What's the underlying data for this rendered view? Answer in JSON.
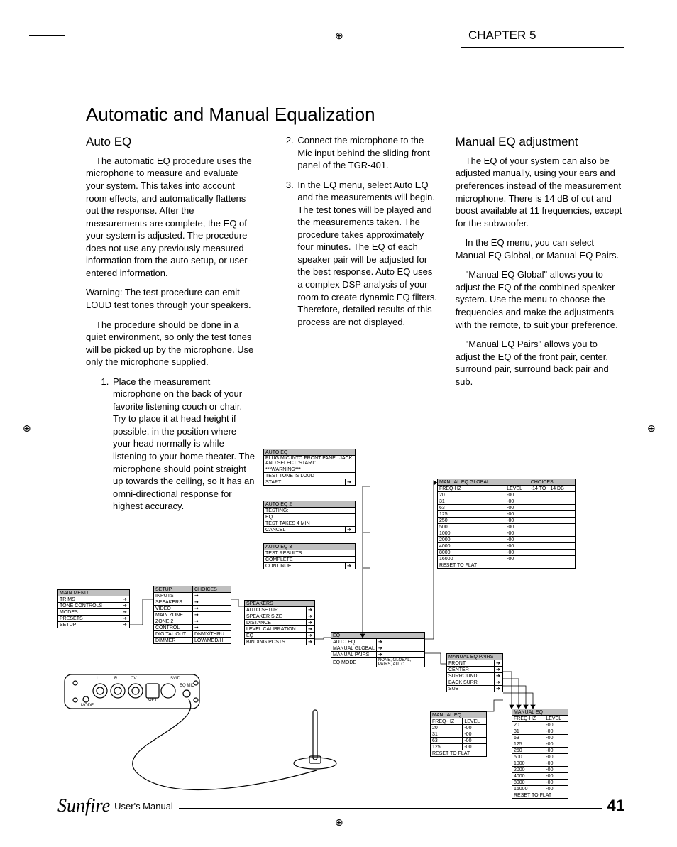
{
  "chapter": "CHAPTER 5",
  "title": "Automatic and Manual Equalization",
  "footer": {
    "brand": "Sunfire",
    "label": "User's Manual",
    "page": "41"
  },
  "col1": {
    "heading": "Auto EQ",
    "p1": "The automatic EQ procedure uses the microphone to measure and evaluate your system. This takes into account room effects, and automatically flattens out the response. After the measurements are complete, the EQ of your system is adjusted. The procedure does not use any previously measured information from the auto setup, or user-entered information.",
    "warn": "Warning: The test procedure can emit LOUD test tones through your speakers.",
    "p2": "The procedure should be done in a quiet environment, so only the test tones will be picked up by the microphone. Use only the microphone supplied.",
    "li1": "Place the measurement microphone on the back of your favorite listening couch or chair. Try to place it at head height if possible, in the position where your head normally is while listening to your home theater. The microphone should point straight up towards the ceiling, so it has an omni-directional response for highest accuracy."
  },
  "col2": {
    "li2": "Connect the microphone to the Mic input behind the sliding front panel of the TGR-401.",
    "li3": "In the EQ menu, select Auto EQ and the measurements will begin. The test tones will be played and the measurements taken. The procedure takes approximately four minutes. The EQ of each speaker pair will be adjusted for the best response. Auto EQ uses a complex DSP analysis of your room to create dynamic EQ filters. Therefore, detailed results of this process are not displayed."
  },
  "col3": {
    "heading": "Manual EQ adjustment",
    "p1": "The EQ of your system can also be adjusted manually, using your ears and preferences instead of the measurement microphone. There is 14 dB of cut and boost available at 11 frequencies, except for the subwoofer.",
    "p2": "In the EQ menu, you can select Manual EQ Global, or Manual EQ Pairs.",
    "p3": "\"Manual EQ Global\" allows you to adjust the EQ of the combined speaker system. Use the menu to choose the frequencies and make the adjustments with the remote, to suit your preference.",
    "p4": "\"Manual EQ Pairs\" allows you to adjust the EQ of the front pair, center, surround pair, surround back pair and sub."
  },
  "menus": {
    "main": {
      "title": "MAIN MENU",
      "rows": [
        "TRIMS",
        "TONE CONTROLS",
        "MODES",
        "PRESETS",
        "SETUP"
      ]
    },
    "setup": {
      "title": "SETUP",
      "choices": "CHOICES",
      "rows": [
        [
          "INPUTS",
          ""
        ],
        [
          "SPEAKERS",
          ""
        ],
        [
          "VIDEO",
          ""
        ],
        [
          "MAIN ZONE",
          ""
        ],
        [
          "ZONE 2",
          ""
        ],
        [
          "CONTROL",
          ""
        ],
        [
          "DIGITAL OUT",
          "DNMX/THRU"
        ],
        [
          "DIMMER",
          "LOW/MED/HI"
        ]
      ]
    },
    "speakers": {
      "title": "SPEAKERS",
      "rows": [
        "AUTO SETUP",
        "SPEAKER SIZE",
        "DISTANCE",
        "LEVEL CALIBRATION",
        "EQ",
        "BINDING POSTS"
      ]
    },
    "eq": {
      "title": "EQ",
      "rows": [
        [
          "AUTO EQ",
          ""
        ],
        [
          "MANUAL GLOBAL",
          ""
        ],
        [
          "MANUAL PAIRS",
          ""
        ],
        [
          "EQ MODE",
          "NONE, GLOBAL, PAIRS, AUTO"
        ]
      ]
    },
    "autoeq1": {
      "title": "AUTO EQ",
      "rows": [
        "PLUG MIC INTO FRONT PANEL JACK AND SELECT 'START'",
        "***WARNING***",
        "TEST TONE IS LOUD",
        "START"
      ]
    },
    "autoeq2": {
      "title": "AUTO EQ 2",
      "rows": [
        "TESTING:",
        "EQ",
        "TEST TAKES 4 MIN",
        "CANCEL"
      ]
    },
    "autoeq3": {
      "title": "AUTO EQ 3",
      "rows": [
        "TEST RESULTS",
        "COMPLETE",
        "CONTINUE"
      ]
    },
    "manpairs": {
      "title": "MANUAL EQ PAIRS",
      "rows": [
        "FRONT",
        "CENTER",
        "SURROUND",
        "BACK SURR",
        "SUB"
      ]
    },
    "mansub": {
      "title": "MANUAL EQ",
      "h1": "FREQ-HZ",
      "h2": "LEVEL",
      "rows": [
        [
          "20",
          "-00"
        ],
        [
          "31",
          "-00"
        ],
        [
          "63",
          "-00"
        ],
        [
          "125",
          "-00"
        ]
      ],
      "reset": "RESET TO FLAT"
    },
    "manfull": {
      "title": "MANUAL EQ",
      "h1": "FREQ-HZ",
      "h2": "LEVEL",
      "rows": [
        [
          "20",
          "-00"
        ],
        [
          "31",
          "-00"
        ],
        [
          "63",
          "-00"
        ],
        [
          "125",
          "-00"
        ],
        [
          "250",
          "-00"
        ],
        [
          "500",
          "-00"
        ],
        [
          "1000",
          "-00"
        ],
        [
          "2000",
          "-00"
        ],
        [
          "4000",
          "-00"
        ],
        [
          "8000",
          "-00"
        ],
        [
          "16000",
          "-00"
        ]
      ],
      "reset": "RESET TO FLAT"
    },
    "manglobal": {
      "title": "MANUAL EQ GLOBAL",
      "h1": "FREQ-HZ",
      "h2": "LEVEL",
      "choices": "CHOICES",
      "range": "-14 TO +14 DB",
      "rows": [
        [
          "20",
          "-00"
        ],
        [
          "31",
          "-00"
        ],
        [
          "63",
          "-00"
        ],
        [
          "125",
          "-00"
        ],
        [
          "250",
          "-00"
        ],
        [
          "500",
          "-00"
        ],
        [
          "1000",
          "-00"
        ],
        [
          "2000",
          "-00"
        ],
        [
          "4000",
          "-00"
        ],
        [
          "8000",
          "-00"
        ],
        [
          "16000",
          "-00"
        ]
      ],
      "reset": "RESET TO FLAT"
    }
  },
  "panel": {
    "labels": {
      "mode": "MODE",
      "l": "L",
      "r": "R",
      "cv": "CV",
      "svid": "SVID",
      "opt": "OPT",
      "eqmic": "EQ MIC"
    }
  }
}
